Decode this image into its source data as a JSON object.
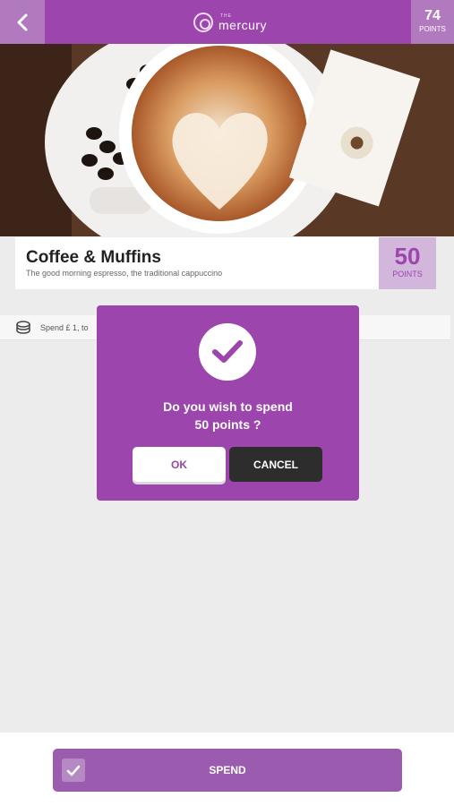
{
  "header": {
    "logo_small": "THE",
    "logo_name": "mercury",
    "points_value": "74",
    "points_label": "POINTS",
    "back_icon": "chevron-left-icon"
  },
  "offer": {
    "title": "Coffee & Muffins",
    "subtitle": "The good morning espresso, the traditional cappuccino",
    "points_value": "50",
    "points_label": "POINTS"
  },
  "info_row": {
    "icon": "coin-stack-icon",
    "text": "Spend £ 1, to"
  },
  "dialog": {
    "icon": "check-icon",
    "message_line1": "Do you wish to spend",
    "message_line2": "50 points ?",
    "ok_label": "OK",
    "cancel_label": "CANCEL"
  },
  "footer": {
    "spend_label": "SPEND",
    "spend_icon": "check-icon"
  },
  "colors": {
    "brand_purple": "#9b45ad",
    "light_purple": "#b17abf",
    "points_bg": "#d2b6db",
    "cancel_dark": "#2d2d2d"
  }
}
